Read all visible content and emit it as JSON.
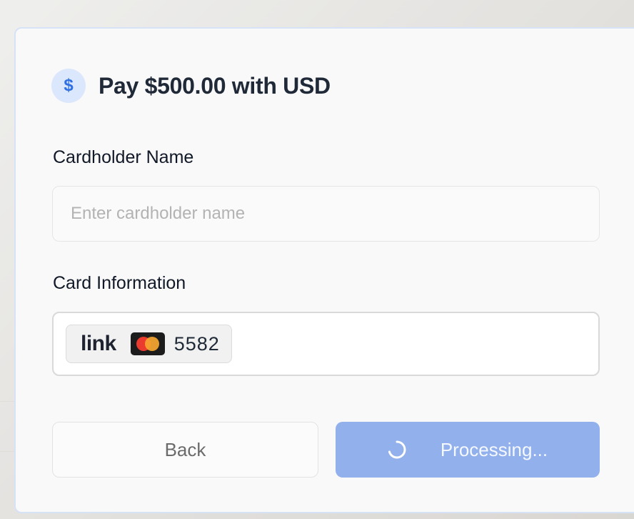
{
  "payment": {
    "currency_symbol": "$",
    "title": "Pay $500.00 with USD",
    "cardholder_label": "Cardholder Name",
    "cardholder_placeholder": "Enter cardholder name",
    "cardholder_value": "",
    "card_info_label": "Card Information",
    "card": {
      "wallet": "link",
      "brand_icon": "mastercard-icon",
      "last4": "5582"
    },
    "back_label": "Back",
    "processing_label": "Processing..."
  },
  "colors": {
    "accent_badge_bg": "#dbe7fc",
    "accent_badge_fg": "#2f6fe4",
    "processing_button_bg": "#92b0ec",
    "mastercard_red": "#eb3b2f",
    "mastercard_orange": "#f7a631"
  }
}
